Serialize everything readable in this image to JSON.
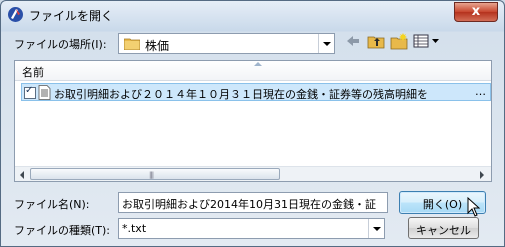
{
  "window": {
    "title": "ファイルを開く",
    "close_label": "x"
  },
  "location": {
    "label": "ファイルの場所(I):",
    "folder": "株価"
  },
  "toolbar": {
    "icons": [
      "back-icon",
      "up-folder-icon",
      "new-folder-icon",
      "view-menu-icon"
    ]
  },
  "list": {
    "column_name": "名前",
    "items": [
      {
        "name": "お取引明細および２０１４年１０月３１日現在の金銭・証券等の残高明細を",
        "overflow": "…",
        "checked": true
      }
    ]
  },
  "filename": {
    "label": "ファイル名(N):",
    "value": "お取引明細および2014年10月31日現在の金銭・証"
  },
  "filetype": {
    "label": "ファイルの種類(T):",
    "value": "*.txt"
  },
  "buttons": {
    "open": "開く(O)",
    "cancel": "キャンセル"
  },
  "colors": {
    "selection": "#cde7fb",
    "close": "#c7452d",
    "folder": "#e8b94a"
  }
}
